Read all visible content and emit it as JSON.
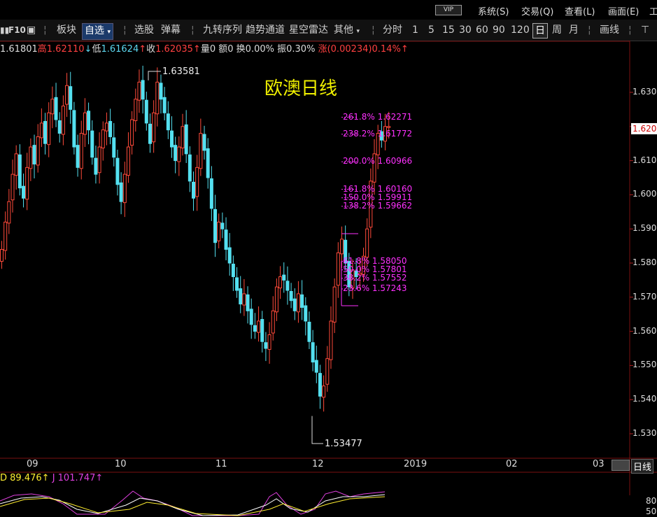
{
  "menu": {
    "vip": "VIP",
    "items": [
      "系统(S)",
      "交易(Q)",
      "查看(L)",
      "画面(E)",
      "工"
    ]
  },
  "toolbar": {
    "f10": "F10",
    "bankuai": "板块",
    "zixuan": "自选",
    "xuangu": "选股",
    "danmu": "弹幕",
    "jiuzhuan": "九转序列",
    "qushi": "趋势通道",
    "xingkong": "星空雷达",
    "qita": "其他",
    "fenshi": "分时",
    "periods": [
      "1",
      "5",
      "15",
      "30",
      "60",
      "90",
      "120"
    ],
    "ri": "日",
    "zhou": "周",
    "yue": "月",
    "huaxian": "画线"
  },
  "quote": {
    "open": "1.61801",
    "high_label": "高",
    "high": "1.62110",
    "low_label": "低",
    "low": "1.61624",
    "close_label": "收",
    "close": "1.62035",
    "vol": "量0",
    "amount": "额0",
    "turnover": "换0.00%",
    "amplitude": "振0.30%",
    "change_label": "涨",
    "change": "(0.00234)",
    "change_pct": "0.14%"
  },
  "kdj": {
    "d": "D 89.476",
    "j": "J 101.747"
  },
  "chart_data": {
    "type": "candlestick",
    "title": "欧澳日线",
    "y_ticks": [
      1.63,
      1.62,
      1.61,
      1.6,
      1.59,
      1.58,
      1.57,
      1.56,
      1.55,
      1.54,
      1.53
    ],
    "y_tick_labels": [
      "1.630",
      "1.620",
      "1.610",
      "1.600",
      "1.590",
      "1.580",
      "1.570",
      "1.560",
      "1.550",
      "1.540",
      "1.530"
    ],
    "ylim": [
      1.528,
      1.6415
    ],
    "x_tick_labels": [
      "09",
      "10",
      "11",
      "12",
      "2019",
      "02",
      "03"
    ],
    "current_price": "1.620",
    "annotations": {
      "high_label": "1.63581",
      "low_label": "1.53477"
    },
    "fib_levels": [
      {
        "pct": "261.8%",
        "price": "1.62271",
        "value": 1.62271
      },
      {
        "pct": "238.2%",
        "price": "1.61772",
        "value": 1.61772
      },
      {
        "pct": "200.0%",
        "price": "1.60966",
        "value": 1.60966
      },
      {
        "pct": "161.8%",
        "price": "1.60160",
        "value": 1.6016
      },
      {
        "pct": "150.0%",
        "price": "1.59911",
        "value": 1.59911
      },
      {
        "pct": "138.2%",
        "price": "1.59662",
        "value": 1.59662
      },
      {
        "pct": "61.8%",
        "price": "1.58050",
        "value": 1.5805
      },
      {
        "pct": "50.0%",
        "price": "1.57801",
        "value": 1.57801
      },
      {
        "pct": "38.2%",
        "price": "1.57552",
        "value": 1.57552
      },
      {
        "pct": "23.6%",
        "price": "1.57243",
        "value": 1.57243
      }
    ],
    "closes": [
      1.584,
      1.592,
      1.598,
      1.606,
      1.612,
      1.602,
      1.599,
      1.608,
      1.614,
      1.609,
      1.617,
      1.621,
      1.615,
      1.624,
      1.628,
      1.622,
      1.618,
      1.626,
      1.632,
      1.625,
      1.614,
      1.608,
      1.618,
      1.624,
      1.619,
      1.611,
      1.606,
      1.614,
      1.619,
      1.621,
      1.617,
      1.611,
      1.603,
      1.598,
      1.606,
      1.614,
      1.622,
      1.628,
      1.633,
      1.628,
      1.621,
      1.615,
      1.624,
      1.633,
      1.628,
      1.624,
      1.619,
      1.614,
      1.61,
      1.614,
      1.62,
      1.612,
      1.604,
      1.599,
      1.608,
      1.618,
      1.613,
      1.605,
      1.596,
      1.586,
      1.592,
      1.59,
      1.584,
      1.58,
      1.576,
      1.572,
      1.568,
      1.571,
      1.566,
      1.562,
      1.56,
      1.563,
      1.557,
      1.555,
      1.559,
      1.566,
      1.573,
      1.576,
      1.575,
      1.572,
      1.569,
      1.566,
      1.571,
      1.567,
      1.563,
      1.557,
      1.551,
      1.548,
      1.541,
      1.544,
      1.552,
      1.563,
      1.573,
      1.583,
      1.587,
      1.58,
      1.573,
      1.578,
      1.576,
      1.577,
      1.582,
      1.59,
      1.604,
      1.612,
      1.618,
      1.616,
      1.62,
      1.62
    ]
  }
}
